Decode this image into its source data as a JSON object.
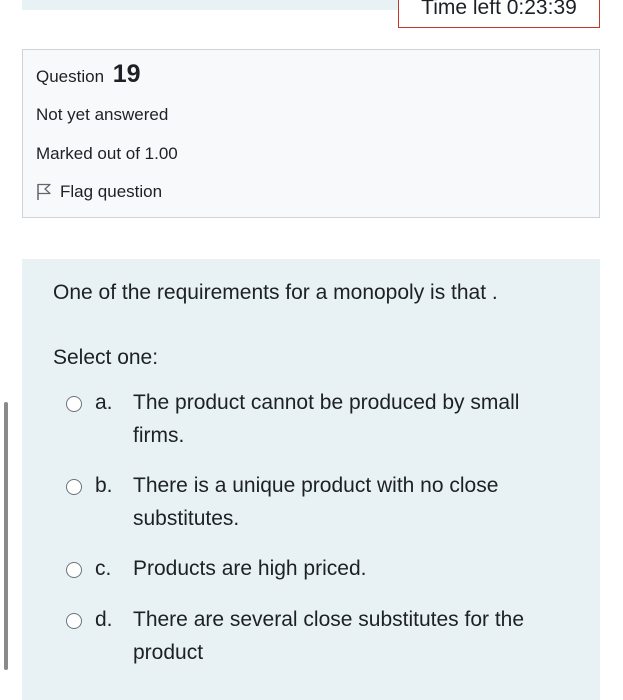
{
  "timer": {
    "text": "Time left 0:23:39"
  },
  "question_info": {
    "label": "Question",
    "number": "19",
    "status": "Not yet answered",
    "marks": "Marked out of 1.00",
    "flag_label": "Flag question"
  },
  "question": {
    "prompt": "One of the requirements for a monopoly is that  .",
    "select_label": "Select one:",
    "options": [
      {
        "letter": "a.",
        "text": "The product cannot be produced by small firms."
      },
      {
        "letter": "b.",
        "text": "There is a unique product with no close substitutes."
      },
      {
        "letter": "c.",
        "text": "Products are high priced."
      },
      {
        "letter": "d.",
        "text": "There are several close substitutes for the product"
      }
    ]
  },
  "colors": {
    "panel_background": "#e8f1f4",
    "info_background": "#f8f9fa",
    "timer_border": "#c0392b"
  },
  "icons": {
    "flag": "flag-icon",
    "radio": "radio-unchecked-icon"
  }
}
